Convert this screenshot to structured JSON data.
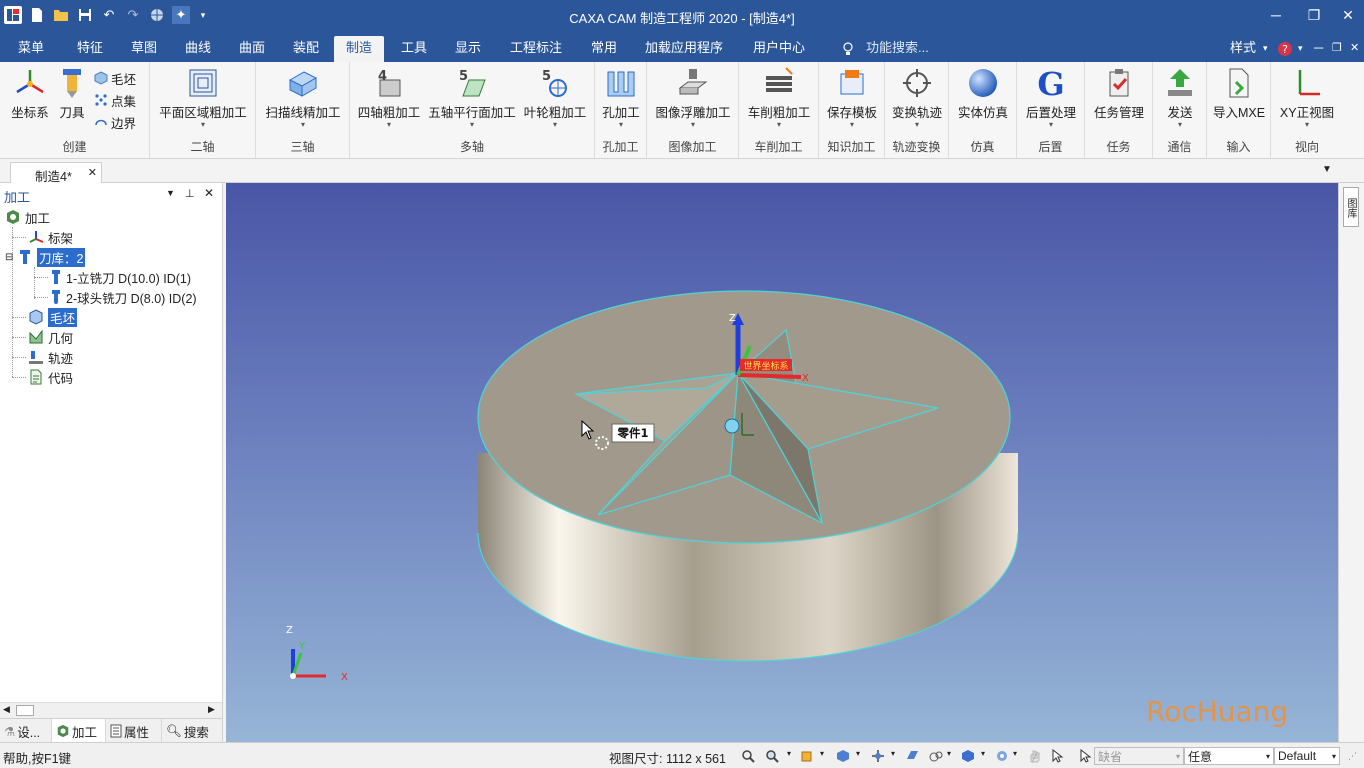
{
  "window": {
    "title": "CAXA CAM 制造工程师 2020 - [制造4*]",
    "accent": "#2b579a"
  },
  "menubar": {
    "items": [
      "菜单",
      "特征",
      "草图",
      "曲线",
      "曲面",
      "装配",
      "制造",
      "工具",
      "显示",
      "工程标注",
      "常用",
      "加载应用程序",
      "用户中心"
    ],
    "active": "制造",
    "search_placeholder": "功能搜索...",
    "style_label": "样式"
  },
  "ribbon": {
    "create": {
      "label": "创建",
      "coord": "坐标系",
      "tool": "刀具",
      "blank": "毛坯",
      "points": "点集",
      "boundary": "边界"
    },
    "two_axis": {
      "label": "二轴",
      "planar": "平面区域粗加工"
    },
    "three_axis": {
      "label": "三轴",
      "scan": "扫描线精加工"
    },
    "multi_axis": {
      "label": "多轴",
      "four_axis": "四轴粗加工",
      "five_axis": "五轴平行面加工",
      "impeller": "叶轮粗加工"
    },
    "hole": {
      "label": "孔加工",
      "hole": "孔加工"
    },
    "image": {
      "label": "图像加工",
      "relief": "图像浮雕加工"
    },
    "turning": {
      "label": "车削加工",
      "rough": "车削粗加工"
    },
    "knowledge": {
      "label": "知识加工",
      "save_template": "保存模板"
    },
    "transform": {
      "label": "轨迹变换",
      "transform": "变换轨迹"
    },
    "simulation": {
      "label": "仿真",
      "solid_sim": "实体仿真"
    },
    "post": {
      "label": "后置",
      "post": "后置处理"
    },
    "task": {
      "label": "任务",
      "task_mgmt": "任务管理"
    },
    "comm": {
      "label": "通信",
      "send": "发送"
    },
    "input": {
      "label": "输入",
      "import_mxe": "导入MXE"
    },
    "view": {
      "label": "视向",
      "xy_view": "XY正视图"
    }
  },
  "doc_tab": {
    "label": "制造4*"
  },
  "panel": {
    "title": "加工",
    "tree": {
      "root": "加工",
      "frame": "标架",
      "toollib": "刀库：2",
      "tool1": "1-立铣刀 D(10.0) ID(1)",
      "tool2": "2-球头铣刀 D(8.0) ID(2)",
      "blank": "毛坯",
      "geometry": "几何",
      "path": "轨迹",
      "code": "代码"
    },
    "bottom_tabs": [
      "设...",
      "加工",
      "属性",
      "搜索"
    ]
  },
  "viewport": {
    "part_label": "零件1",
    "world_coord_label": "世界坐标系",
    "axis_x": "X",
    "axis_y": "Y",
    "axis_z": "Z",
    "watermark": "RocHuang"
  },
  "right_strip": {
    "label": "图库"
  },
  "statusbar": {
    "help": "帮助,按F1键",
    "view_size": "视图尺寸: 1112 x  561",
    "field1": "缺省",
    "field2": "任意",
    "field3": "Default"
  }
}
